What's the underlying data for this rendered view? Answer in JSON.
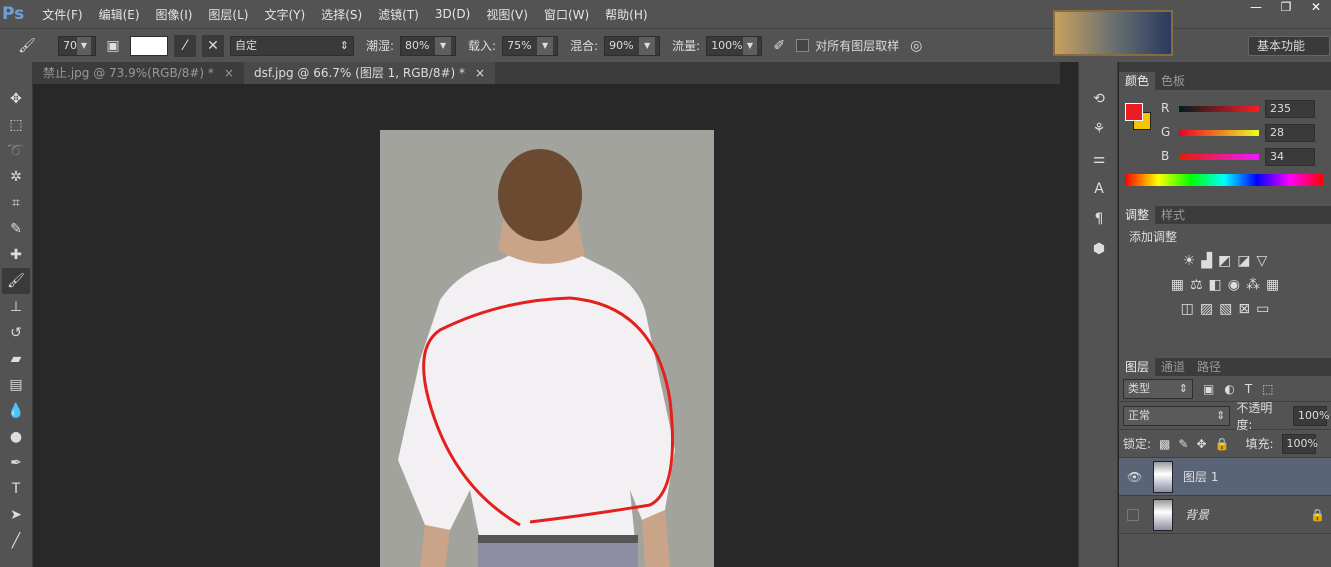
{
  "app": {
    "logo": "Ps",
    "menus": [
      "文件(F)",
      "编辑(E)",
      "图像(I)",
      "图层(L)",
      "文字(Y)",
      "选择(S)",
      "滤镜(T)",
      "3D(D)",
      "视图(V)",
      "窗口(W)",
      "帮助(H)"
    ],
    "window_controls": [
      "—",
      "❐",
      "✕"
    ],
    "workspace": "基本功能"
  },
  "options": {
    "brush_size": "70",
    "preset": "自定",
    "wet_label": "潮湿:",
    "wet": "80%",
    "load_label": "载入:",
    "load": "75%",
    "mix_label": "混合:",
    "mix": "90%",
    "flow_label": "流量:",
    "flow": "100%",
    "sample_all": "对所有图层取样"
  },
  "tabs": [
    {
      "title": "禁止.jpg @ 73.9%(RGB/8#) *",
      "close": "×"
    },
    {
      "title": "dsf.jpg @ 66.7% (图层 1, RGB/8#) *",
      "close": "×"
    }
  ],
  "color_panel": {
    "tabs": [
      "颜色",
      "色板"
    ],
    "r_label": "R",
    "r": "235",
    "g_label": "G",
    "g": "28",
    "b_label": "B",
    "b": "34",
    "fg": "#eb1c22",
    "bg": "#f5c400"
  },
  "adjust_panel": {
    "tabs": [
      "调整",
      "样式"
    ],
    "title": "添加调整"
  },
  "layers_panel": {
    "tabs": [
      "图层",
      "通道",
      "路径"
    ],
    "filter": "类型",
    "blend": "正常",
    "opacity_label": "不透明度:",
    "opacity": "100%",
    "lock_label": "锁定:",
    "fill_label": "填充:",
    "fill": "100%",
    "layers": [
      {
        "name": "图层 1",
        "visible": true
      },
      {
        "name": "背景",
        "visible": false
      }
    ]
  }
}
